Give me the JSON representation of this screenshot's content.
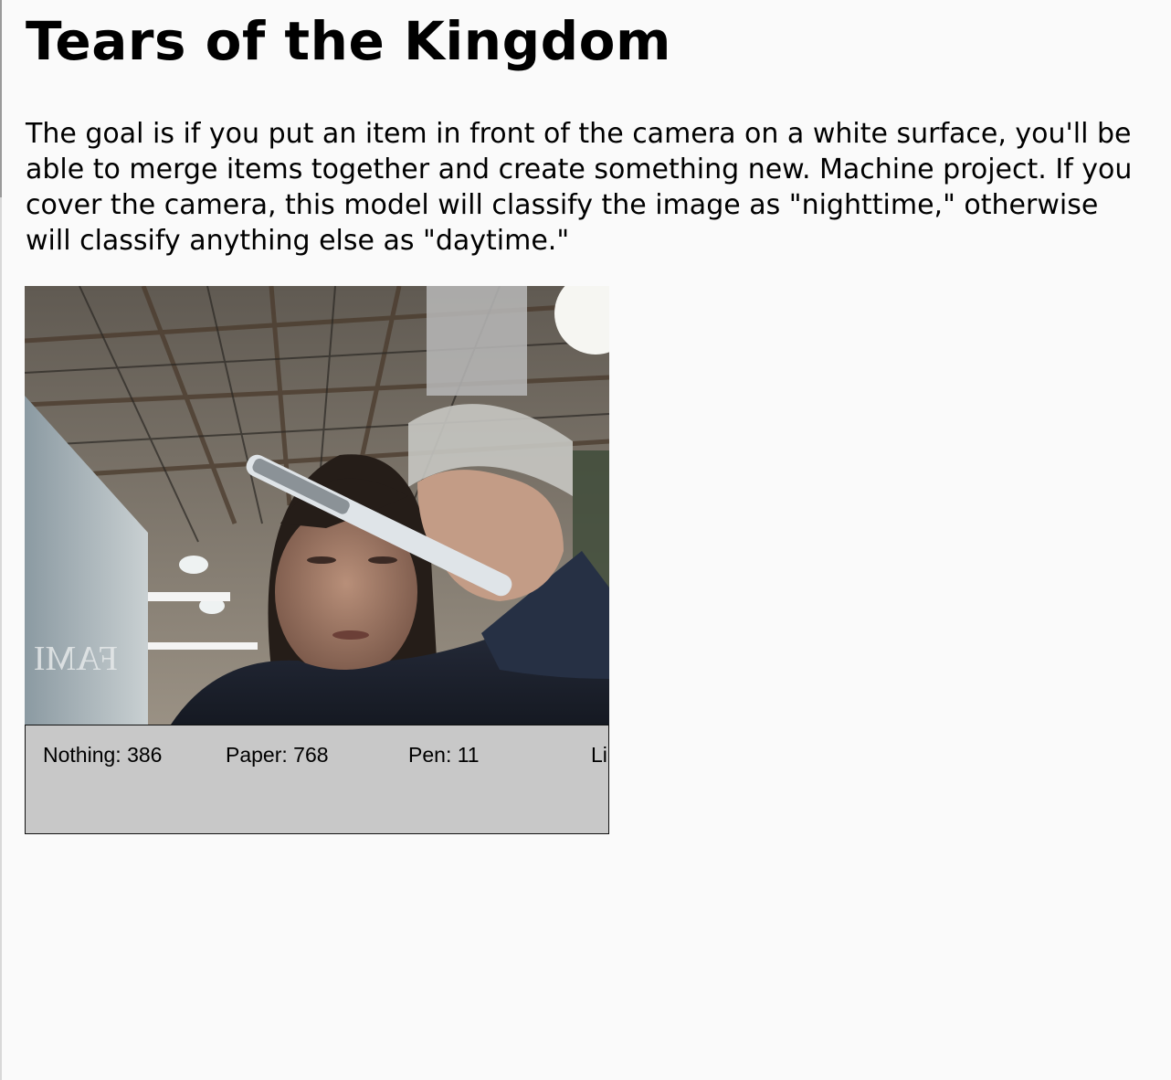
{
  "page": {
    "title": "Tears of the Kingdom",
    "description": "The goal is if you put an item in front of the camera on a white surface, you'll be able to merge items together and create something new. Machine project. If you cover the camera, this model will classify the image as \"nighttime,\" otherwise will classify anything else as \"daytime.\""
  },
  "camera_feed": {
    "subject": "person holding a pen in front of the camera"
  },
  "labels": [
    {
      "name": "Nothing",
      "count": "386"
    },
    {
      "name": "Paper",
      "count": "768"
    },
    {
      "name": "Pen",
      "count": "11"
    },
    {
      "name": "Li",
      "count": ""
    }
  ],
  "colors": {
    "page_background": "#fafafa",
    "label_bar_background": "#c8c8c8"
  }
}
